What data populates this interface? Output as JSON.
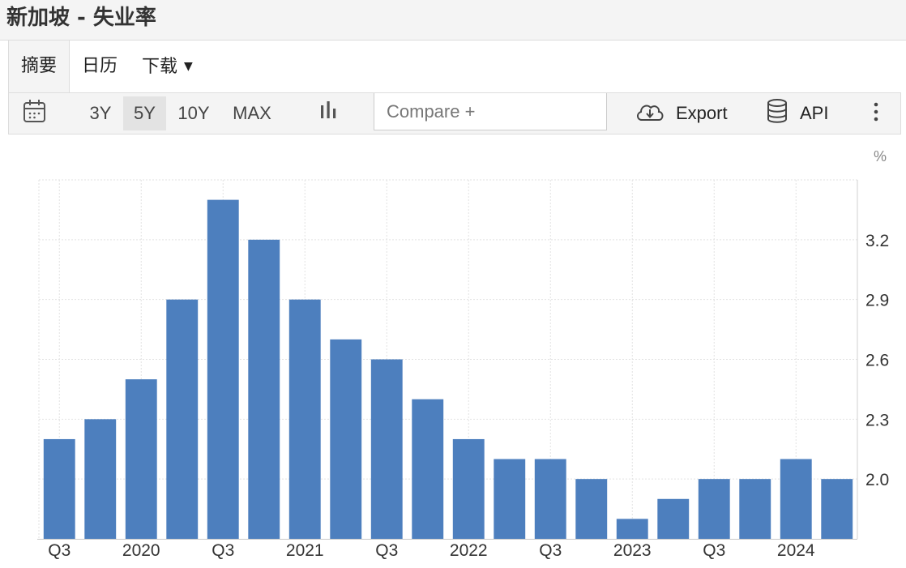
{
  "header": {
    "title": "新加坡 - 失业率"
  },
  "tabs": [
    {
      "label": "摘要",
      "active": true
    },
    {
      "label": "日历",
      "active": false
    },
    {
      "label": "下载",
      "active": false
    }
  ],
  "toolbar": {
    "ranges": [
      "3Y",
      "5Y",
      "10Y",
      "MAX"
    ],
    "active_range": "5Y",
    "compare_placeholder": "Compare +",
    "export_label": "Export",
    "api_label": "API"
  },
  "colors": {
    "bar": "#4d7fbe",
    "grid": "#e2e2e2",
    "axis_text": "#333333",
    "unit_text": "#888888"
  },
  "chart_data": {
    "type": "bar",
    "unit": "%",
    "values": [
      2.2,
      2.3,
      2.5,
      2.9,
      3.4,
      3.2,
      2.9,
      2.7,
      2.6,
      2.4,
      2.2,
      2.1,
      2.1,
      2.0,
      1.8,
      1.9,
      2.0,
      2.0,
      2.1,
      2.0
    ],
    "x_ticks": [
      {
        "index": 0,
        "label": "Q3"
      },
      {
        "index": 2,
        "label": "2020"
      },
      {
        "index": 4,
        "label": "Q3"
      },
      {
        "index": 6,
        "label": "2021"
      },
      {
        "index": 8,
        "label": "Q3"
      },
      {
        "index": 10,
        "label": "2022"
      },
      {
        "index": 12,
        "label": "Q3"
      },
      {
        "index": 14,
        "label": "2023"
      },
      {
        "index": 16,
        "label": "Q3"
      },
      {
        "index": 18,
        "label": "2024"
      }
    ],
    "y_ticks": [
      2.0,
      2.3,
      2.6,
      2.9,
      3.2
    ],
    "ylim": [
      1.7,
      3.5
    ],
    "grid": true,
    "y_axis_position": "right"
  }
}
